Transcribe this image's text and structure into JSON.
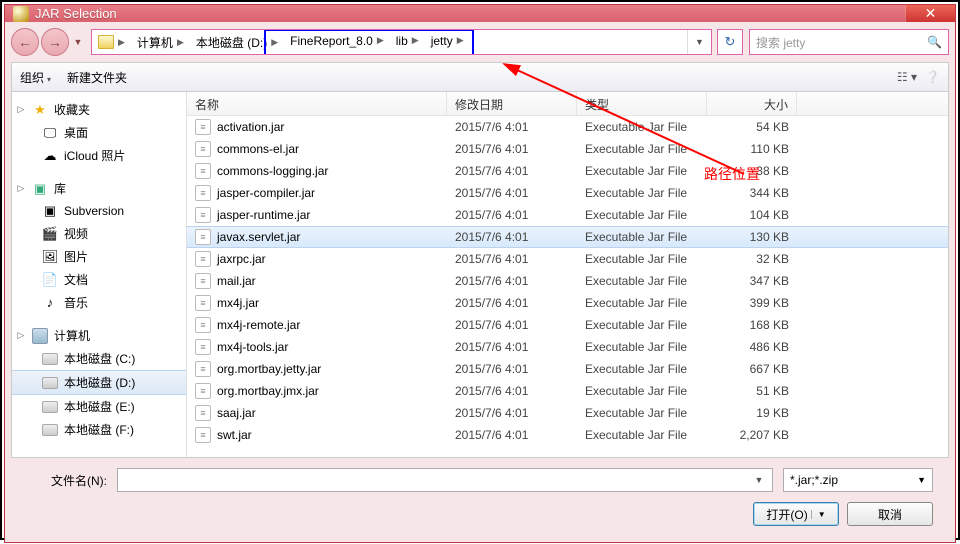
{
  "title": "JAR Selection",
  "breadcrumb": [
    "计算机",
    "本地磁盘 (D:)",
    "FineReport_8.0",
    "lib",
    "jetty"
  ],
  "search_placeholder": "搜索 jetty",
  "toolbar": {
    "organize": "组织",
    "newfolder": "新建文件夹"
  },
  "columns": {
    "name": "名称",
    "date": "修改日期",
    "type": "类型",
    "size": "大小"
  },
  "sidebar": {
    "fav": {
      "label": "收藏夹",
      "items": [
        "桌面",
        "iCloud 照片"
      ]
    },
    "lib": {
      "label": "库",
      "items": [
        "Subversion",
        "视频",
        "图片",
        "文档",
        "音乐"
      ]
    },
    "comp": {
      "label": "计算机",
      "items": [
        "本地磁盘 (C:)",
        "本地磁盘 (D:)",
        "本地磁盘 (E:)",
        "本地磁盘 (F:)"
      ]
    }
  },
  "files": [
    {
      "name": "activation.jar",
      "date": "2015/7/6 4:01",
      "type": "Executable Jar File",
      "size": "54 KB"
    },
    {
      "name": "commons-el.jar",
      "date": "2015/7/6 4:01",
      "type": "Executable Jar File",
      "size": "110 KB"
    },
    {
      "name": "commons-logging.jar",
      "date": "2015/7/6 4:01",
      "type": "Executable Jar File",
      "size": "38 KB"
    },
    {
      "name": "jasper-compiler.jar",
      "date": "2015/7/6 4:01",
      "type": "Executable Jar File",
      "size": "344 KB"
    },
    {
      "name": "jasper-runtime.jar",
      "date": "2015/7/6 4:01",
      "type": "Executable Jar File",
      "size": "104 KB"
    },
    {
      "name": "javax.servlet.jar",
      "date": "2015/7/6 4:01",
      "type": "Executable Jar File",
      "size": "130 KB",
      "selected": true
    },
    {
      "name": "jaxrpc.jar",
      "date": "2015/7/6 4:01",
      "type": "Executable Jar File",
      "size": "32 KB"
    },
    {
      "name": "mail.jar",
      "date": "2015/7/6 4:01",
      "type": "Executable Jar File",
      "size": "347 KB"
    },
    {
      "name": "mx4j.jar",
      "date": "2015/7/6 4:01",
      "type": "Executable Jar File",
      "size": "399 KB"
    },
    {
      "name": "mx4j-remote.jar",
      "date": "2015/7/6 4:01",
      "type": "Executable Jar File",
      "size": "168 KB"
    },
    {
      "name": "mx4j-tools.jar",
      "date": "2015/7/6 4:01",
      "type": "Executable Jar File",
      "size": "486 KB"
    },
    {
      "name": "org.mortbay.jetty.jar",
      "date": "2015/7/6 4:01",
      "type": "Executable Jar File",
      "size": "667 KB"
    },
    {
      "name": "org.mortbay.jmx.jar",
      "date": "2015/7/6 4:01",
      "type": "Executable Jar File",
      "size": "51 KB"
    },
    {
      "name": "saaj.jar",
      "date": "2015/7/6 4:01",
      "type": "Executable Jar File",
      "size": "19 KB"
    },
    {
      "name": "swt.jar",
      "date": "2015/7/6 4:01",
      "type": "Executable Jar File",
      "size": "2,207 KB"
    }
  ],
  "filename_label": "文件名(N):",
  "filter": "*.jar;*.zip",
  "buttons": {
    "open": "打开(O)",
    "cancel": "取消"
  },
  "annotation": "路径位置"
}
